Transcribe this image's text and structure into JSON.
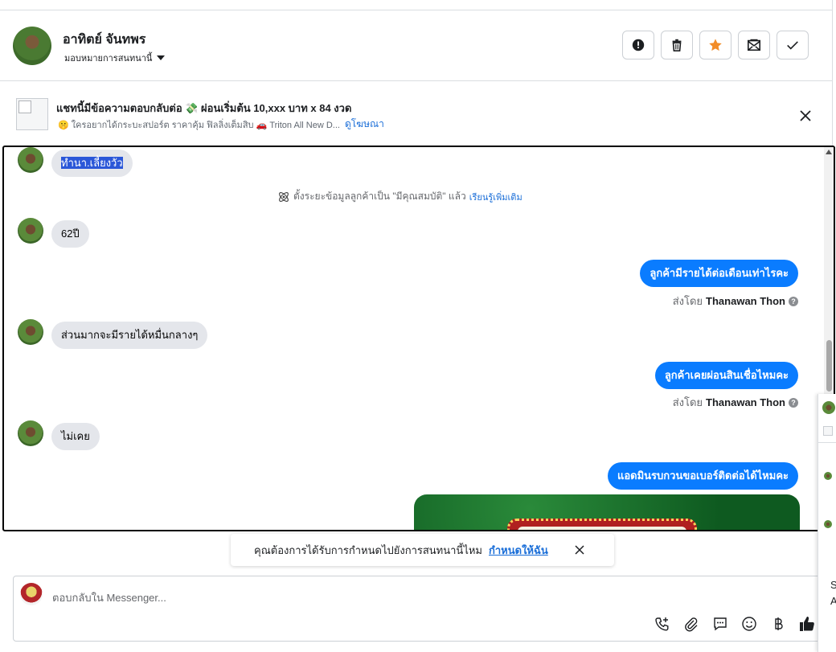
{
  "header": {
    "name": "อาทิตย์ จันทพร",
    "assign_label": "มอบหมายการสนทนานี้",
    "actions": [
      {
        "name": "mark-spam-button",
        "icon": "alert-icon"
      },
      {
        "name": "delete-button",
        "icon": "trash-icon"
      },
      {
        "name": "star-button",
        "icon": "star-icon"
      },
      {
        "name": "mark-unread-button",
        "icon": "envelope-icon"
      },
      {
        "name": "mark-done-button",
        "icon": "check-icon"
      }
    ]
  },
  "ad": {
    "title": "แชทนี้มีข้อความตอบกลับต่อ 💸 ผ่อนเริ่มต้น 10,xxx บาท x 84 งวด",
    "subtitle": "🤫 ใครอยากได้กระบะสปอร์ต ราคาคุ้ม ฟิลลิ่งเต็มสิบ 🚗 Triton All New D...",
    "link": "ดูโฆษณา"
  },
  "messages": {
    "m1": "ทำนา.เลี้ยงวัว",
    "system_note": "ตั้งระยะข้อมูลลูกค้าเป็น \"มีคุณสมบัติ\" แล้ว",
    "system_link": "เรียนรู้เพิ่มเติม",
    "m2": "62ปี",
    "m3": "ลูกค้ามีรายได้ต่อเดือนเท่าไรคะ",
    "m4": "ส่วนมากจะมีรายได้หมื่นกลางๆ",
    "m5": "ลูกค้าเคยผ่อนสินเชื่อไหมคะ",
    "m6": "ไม่เคย",
    "m7": "แอดมินรบกวนขอเบอร์ติดต่อได้ไหมคะ",
    "sent_by_prefix": "ส่งโดย",
    "sent_by_name": "Thanawan Thon",
    "help_mark": "?"
  },
  "toast": {
    "text": "คุณต้องการได้รับการกำหนดไปยังการสนทนานี้ไหม",
    "link": "กำหนดให้ฉัน"
  },
  "composer": {
    "placeholder": "ตอบกลับใน Messenger..."
  },
  "side_panel": {
    "letters": [
      "S",
      "A"
    ]
  },
  "colors": {
    "outgoing": "#0a7cff",
    "incoming": "#e4e6eb",
    "link": "#1a6ed8",
    "star": "#f28c28"
  }
}
